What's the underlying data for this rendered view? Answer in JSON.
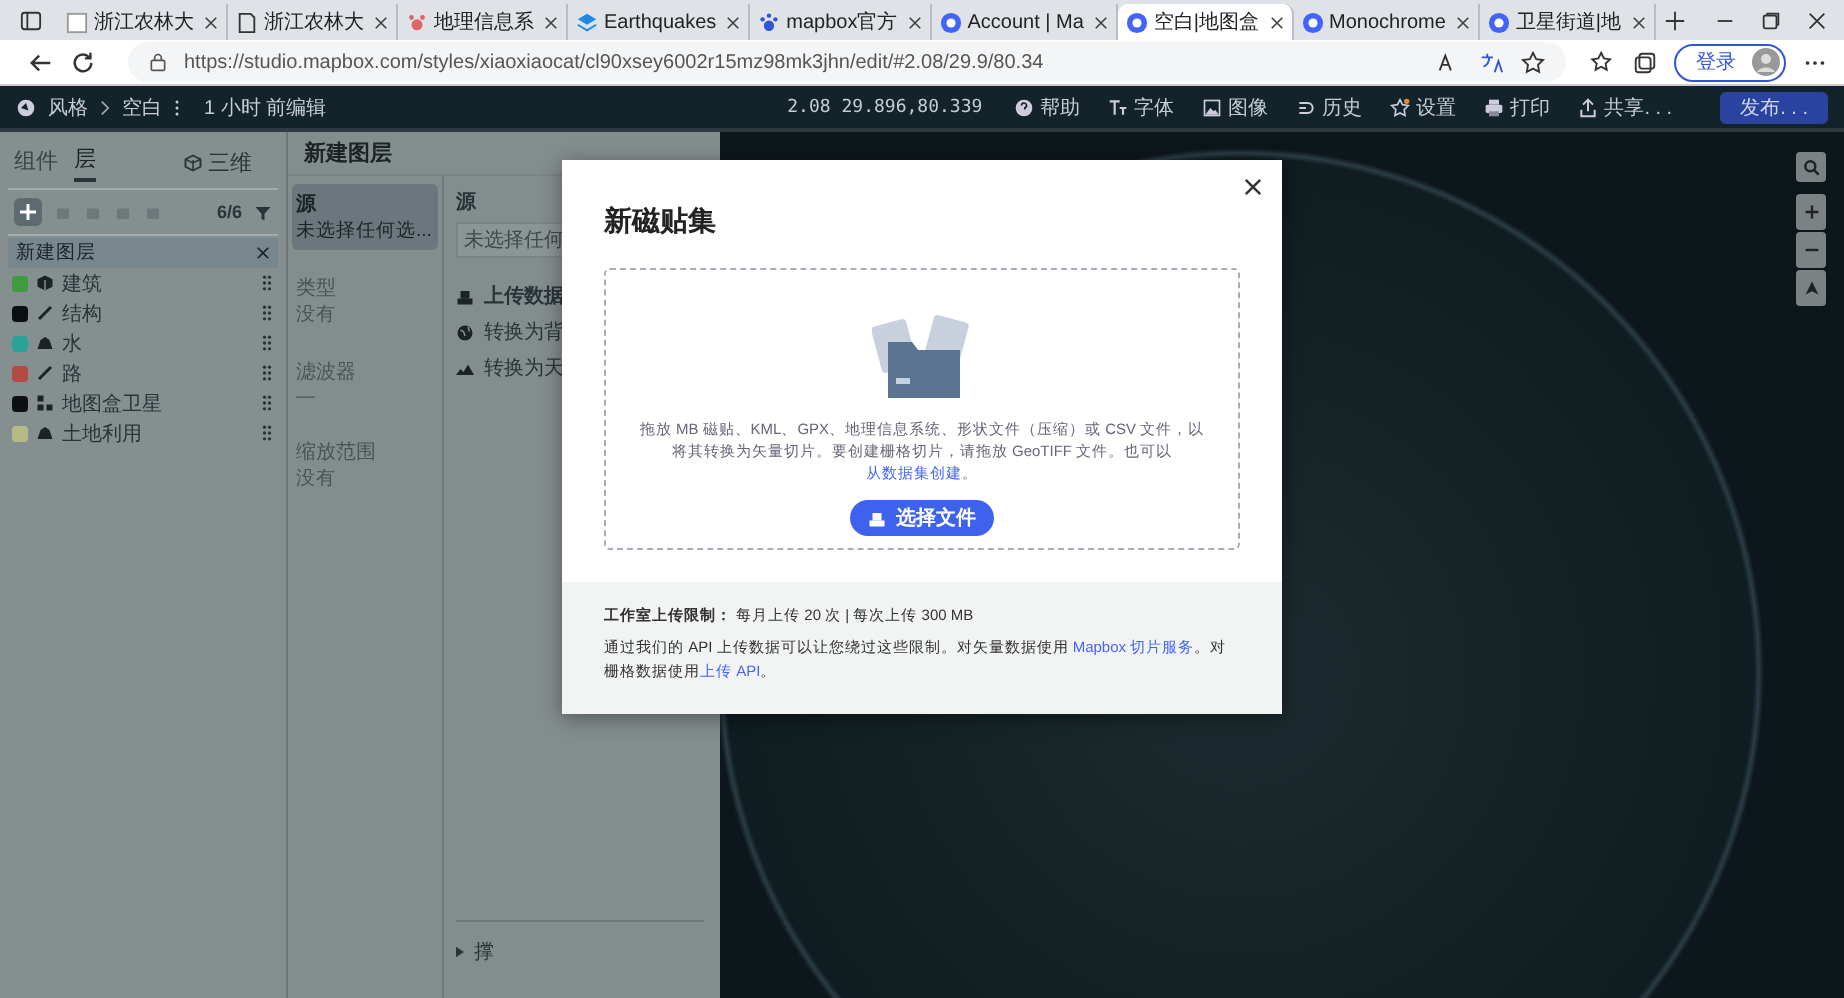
{
  "browser": {
    "tabs": [
      {
        "title": "浙江农林大",
        "kind": "page",
        "selected": false
      },
      {
        "title": "浙江农林大",
        "kind": "doc",
        "selected": false
      },
      {
        "title": "地理信息系",
        "kind": "gis",
        "selected": false
      },
      {
        "title": "Earthquakes",
        "kind": "layers",
        "selected": false
      },
      {
        "title": "mapbox官方",
        "kind": "paw",
        "selected": false
      },
      {
        "title": "Account | Ma",
        "kind": "mapbox",
        "selected": false
      },
      {
        "title": "空白|地图盒",
        "kind": "mapbox",
        "selected": true
      },
      {
        "title": "Monochrome",
        "kind": "mapbox",
        "selected": false
      },
      {
        "title": "卫星街道|地",
        "kind": "mapbox",
        "selected": false
      }
    ],
    "address": "https://studio.mapbox.com/styles/xiaoxiaocat/cl90xsey6002r15mz98mk3jhn/edit/#2.08/29.9/80.34",
    "login": "登录"
  },
  "toolbar": {
    "crumbs": [
      "风格",
      "空白"
    ],
    "edited": "1 小时 前编辑",
    "coords": "2.08 29.896,80.339",
    "actions": [
      {
        "label": "帮助",
        "kind": "help"
      },
      {
        "label": "字体",
        "kind": "font"
      },
      {
        "label": "图像",
        "kind": "image"
      },
      {
        "label": "历史",
        "kind": "history"
      },
      {
        "label": "设置",
        "kind": "settings"
      },
      {
        "label": "打印",
        "kind": "print"
      },
      {
        "label": "共享. . .",
        "kind": "share"
      }
    ],
    "publish": "发布. . ."
  },
  "layers_panel": {
    "tabs": [
      {
        "label": "组件",
        "selected": false
      },
      {
        "label": "层",
        "selected": true
      }
    ],
    "view_3d": "三维",
    "count": "6/6",
    "group": "新建图层",
    "layers": [
      {
        "name": "建筑",
        "color": "#3f9b3f",
        "kind": "cube"
      },
      {
        "name": "结构",
        "color": "#0c0f10",
        "kind": "line"
      },
      {
        "name": "水",
        "color": "#2aa396",
        "kind": "fill"
      },
      {
        "name": "路",
        "color": "#b24b44",
        "kind": "line"
      },
      {
        "name": "地图盒卫星",
        "color": "#0c0f10",
        "kind": "raster"
      },
      {
        "name": "土地利用",
        "color": "#b6bb86",
        "kind": "fill"
      }
    ]
  },
  "layer_editor": {
    "title": "新建图层",
    "sections": [
      {
        "label": "源",
        "value": "未选择任何选...",
        "selected": true
      },
      {
        "label": "类型",
        "value": "没有",
        "selected": false
      },
      {
        "label": "滤波器",
        "value": "—",
        "selected": false
      },
      {
        "label": "缩放范围",
        "value": "没有",
        "selected": false
      }
    ],
    "source_label": "源",
    "source_placeholder": "未选择任何",
    "options": [
      {
        "label": "上传数据",
        "kind": "upload"
      },
      {
        "label": "转换为背",
        "kind": "globe"
      },
      {
        "label": "转换为天",
        "kind": "sky"
      }
    ],
    "footer": "撑"
  },
  "dialog": {
    "title": "新磁贴集",
    "drop_text": [
      {
        "text": "拖放 MB 磁贴、KML、GPX、地理信息系统、形状文件（压缩）或 CSV 文件，以将其转换为矢量切片。要创建栅格切片，请拖放 GeoTIFF 文件。也可以",
        "link": false
      },
      {
        "text": "从数据集创建",
        "link": true
      },
      {
        "text": "。",
        "link": false
      }
    ],
    "button": "选择文件",
    "limits": "**工作室上传限制：** 每月上传 20 次 | 每次上传 300 MB",
    "api_text": [
      {
        "text": "通过我们的 API 上传数据可以让您绕过这些限制。对矢量数据使用 ",
        "link": false
      },
      {
        "text": "Mapbox 切片服务",
        "link": true
      },
      {
        "text": "。对栅格数据使用",
        "link": false
      },
      {
        "text": "上传 API",
        "link": true
      },
      {
        "text": "。",
        "link": false
      }
    ]
  }
}
